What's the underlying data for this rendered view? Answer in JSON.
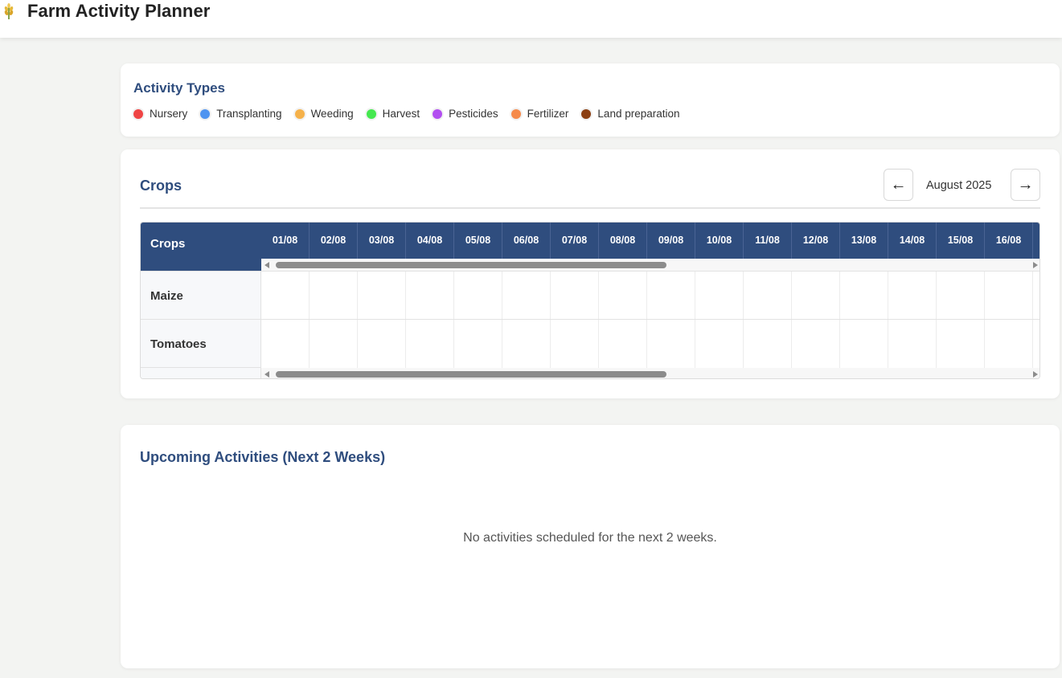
{
  "header": {
    "title": "Farm Activity Planner",
    "logo_icon": "wheat-icon"
  },
  "activity_types": {
    "title": "Activity Types",
    "items": [
      {
        "label": "Nursery",
        "color": "#ef4444"
      },
      {
        "label": "Transplanting",
        "color": "#4f94f0"
      },
      {
        "label": "Weeding",
        "color": "#f5b14a"
      },
      {
        "label": "Harvest",
        "color": "#45e84f"
      },
      {
        "label": "Pesticides",
        "color": "#b24ef0"
      },
      {
        "label": "Fertilizer",
        "color": "#f58a4a"
      },
      {
        "label": "Land preparation",
        "color": "#8b3f12"
      }
    ]
  },
  "crops": {
    "title": "Crops",
    "month_label": "August 2025",
    "prev_label": "←",
    "next_label": "→",
    "column_header": "Crops",
    "dates": [
      "01/08",
      "02/08",
      "03/08",
      "04/08",
      "05/08",
      "06/08",
      "07/08",
      "08/08",
      "09/08",
      "10/08",
      "11/08",
      "12/08",
      "13/08",
      "14/08",
      "15/08",
      "16/08"
    ],
    "rows": [
      {
        "name": "Maize"
      },
      {
        "name": "Tomatoes"
      }
    ]
  },
  "upcoming": {
    "title": "Upcoming Activities (Next 2 Weeks)",
    "empty_message": "No activities scheduled for the next 2 weeks."
  },
  "colors": {
    "primary": "#2f4d7e",
    "background": "#f3f4f2"
  }
}
